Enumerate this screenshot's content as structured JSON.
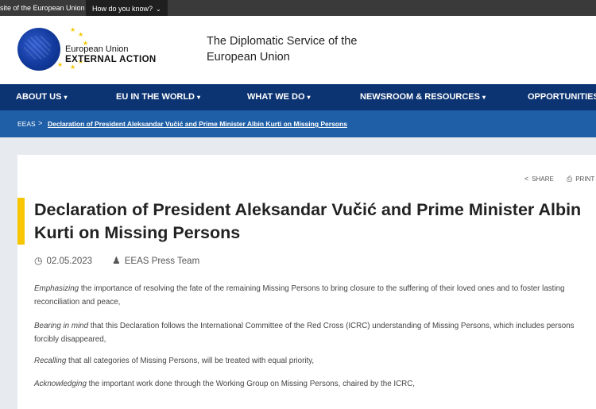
{
  "topbar": {
    "official_text": "site of the European Union",
    "how_know": "How do you know?"
  },
  "header": {
    "brand_line1": "European Union",
    "brand_line2": "EXTERNAL ACTION",
    "tagline_line1": "The Diplomatic Service of the",
    "tagline_line2": "European Union"
  },
  "nav": {
    "items": [
      {
        "label": "ABOUT US"
      },
      {
        "label": "EU IN THE WORLD"
      },
      {
        "label": "WHAT WE DO"
      },
      {
        "label": "NEWSROOM & RESOURCES"
      },
      {
        "label": "OPPORTUNITIES"
      }
    ]
  },
  "breadcrumb": {
    "home": "EEAS",
    "separator": ">",
    "current": "Declaration of President Aleksandar Vučić and Prime Minister Albin Kurti on Missing Persons"
  },
  "actions": {
    "share": "SHARE",
    "print": "PRINT"
  },
  "article": {
    "title": "Declaration of President Aleksandar Vučić and Prime Minister Albin Kurti on Missing Persons",
    "date": "02.05.2023",
    "author": "EEAS Press Team",
    "paragraphs": [
      {
        "lead": "Emphasizing",
        "rest": " the importance of resolving the fate of the remaining Missing Persons to bring closure to the suffering of their loved ones and to foster lasting reconciliation and peace,"
      },
      {
        "lead": "Bearing in mind",
        "rest": " that this Declaration follows the International Committee of the Red Cross (ICRC) understanding of Missing Persons, which includes persons forcibly disappeared,"
      },
      {
        "lead": "Recalling",
        "rest": " that all categories of Missing Persons, will be treated with equal priority,"
      },
      {
        "lead": "Acknowledging",
        "rest": " the important work done through the Working Group on Missing Persons, chaired by the ICRC,"
      }
    ]
  },
  "colors": {
    "nav_bg": "#0d3472",
    "breadcrumb_bg": "#1f5fa7",
    "accent_yellow": "#f7c600"
  }
}
